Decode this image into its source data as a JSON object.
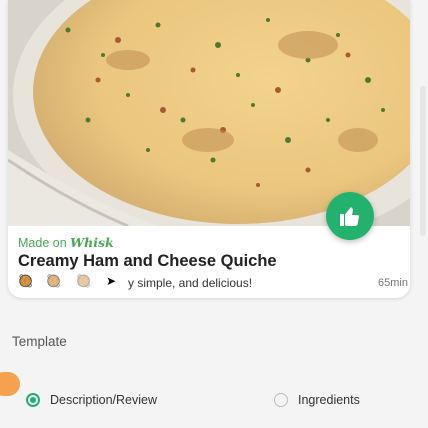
{
  "recipe": {
    "made_on_prefix": "Made on",
    "brand": "Whisk",
    "title": "Creamy Ham and Cheese Quiche",
    "description": "y simple, and delicious!",
    "time": "65min"
  },
  "colors": {
    "accent": "#23b26d",
    "brand_green": "#4aaa55"
  },
  "icons": {
    "like": "thumbs-up-icon",
    "scroll": "scroll-track"
  },
  "section": {
    "title": "Template"
  },
  "tabs": [
    {
      "label": "Description/Review",
      "selected": true
    },
    {
      "label": "Ingredients",
      "selected": false
    }
  ]
}
